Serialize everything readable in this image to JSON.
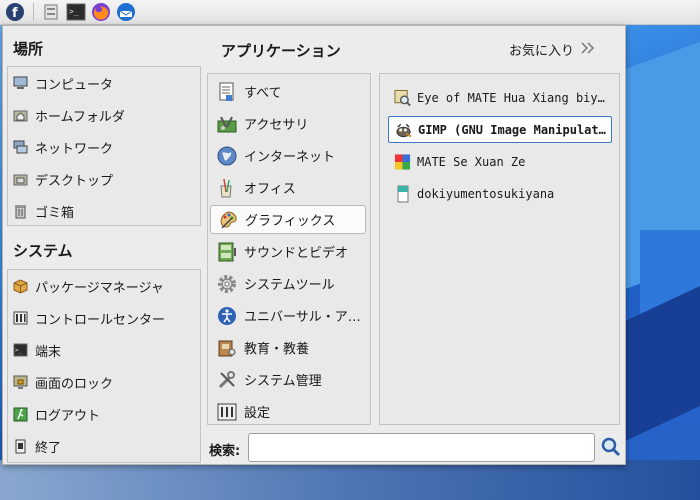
{
  "panel": {
    "icons": [
      "fedora-logo-icon",
      "file-manager-icon",
      "terminal-icon",
      "firefox-icon",
      "thunderbird-icon"
    ]
  },
  "places": {
    "title": "場所",
    "items": [
      {
        "label": "コンピュータ",
        "icon": "computer-icon"
      },
      {
        "label": "ホームフォルダ",
        "icon": "home-folder-icon"
      },
      {
        "label": "ネットワーク",
        "icon": "network-icon"
      },
      {
        "label": "デスクトップ",
        "icon": "desktop-folder-icon"
      },
      {
        "label": "ゴミ箱",
        "icon": "trash-icon"
      }
    ]
  },
  "system": {
    "title": "システム",
    "items": [
      {
        "label": "パッケージマネージャ",
        "icon": "package-icon"
      },
      {
        "label": "コントロールセンター",
        "icon": "control-center-icon"
      },
      {
        "label": "端末",
        "icon": "terminal-icon"
      },
      {
        "label": "画面のロック",
        "icon": "lock-screen-icon"
      },
      {
        "label": "ログアウト",
        "icon": "logout-icon"
      },
      {
        "label": "終了",
        "icon": "shutdown-icon"
      }
    ]
  },
  "applications": {
    "title": "アプリケーション",
    "favorites_label": "お気に入り",
    "categories": [
      {
        "label": "すべて",
        "icon": "all-apps-icon"
      },
      {
        "label": "アクセサリ",
        "icon": "accessories-icon"
      },
      {
        "label": "インターネット",
        "icon": "internet-globe-icon"
      },
      {
        "label": "オフィス",
        "icon": "office-icon"
      },
      {
        "label": "グラフィックス",
        "icon": "graphics-palette-icon"
      },
      {
        "label": "サウンドとビデオ",
        "icon": "sound-video-icon"
      },
      {
        "label": "システムツール",
        "icon": "system-tools-gear-icon"
      },
      {
        "label": "ユニバーサル・ア…",
        "icon": "universal-access-icon"
      },
      {
        "label": "教育・教養",
        "icon": "education-icon"
      },
      {
        "label": "システム管理",
        "icon": "administration-tools-icon"
      },
      {
        "label": "設定",
        "icon": "settings-icon"
      }
    ],
    "selected_category": "グラフィックス",
    "apps": [
      {
        "label": "Eye of MATE Hua Xiang biyua",
        "icon": "image-viewer-icon"
      },
      {
        "label": "GIMP (GNU Image Manipulat…",
        "icon": "gimp-icon"
      },
      {
        "label": "MATE Se Xuan Ze",
        "icon": "color-picker-icon"
      },
      {
        "label": "dokiyumentosukiyana",
        "icon": "document-scanner-icon"
      }
    ],
    "selected_app": "GIMP (GNU Image Manipulat…"
  },
  "search": {
    "label": "検索:",
    "value": "",
    "placeholder": ""
  },
  "colors": {
    "selection_border": "#3b78c7",
    "menu_background": "#ececec"
  }
}
